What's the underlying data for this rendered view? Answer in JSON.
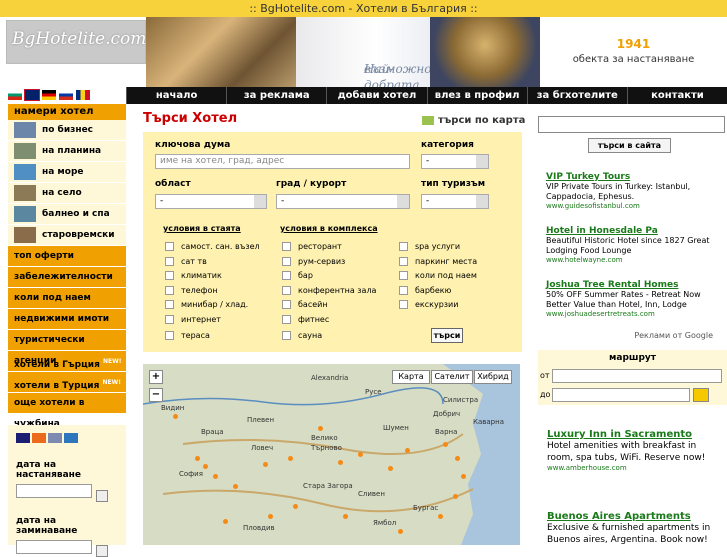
{
  "top_title": ":: BgHotelite.com - Хотели в България ::",
  "header": {
    "logo_text": "BgHotelite.com",
    "slogan_line1": "Най-добрата",
    "slogan_line2": "възможност!",
    "counter_number": "1941",
    "counter_text": "обекта за настаняване"
  },
  "nav": [
    "начало",
    "за реклама",
    "добави хотел",
    "влез в профил",
    "за бгхотелите",
    "контакти"
  ],
  "sidebar": {
    "title": "намери хотел",
    "items": [
      {
        "label": "по бизнес",
        "color": "#6b86a8"
      },
      {
        "label": "на планина",
        "color": "#7d8f70"
      },
      {
        "label": "на море",
        "color": "#4f8fc4"
      },
      {
        "label": "на село",
        "color": "#8b7a55"
      },
      {
        "label": "балнео и спа",
        "color": "#5b88a0"
      },
      {
        "label": "старовремски",
        "color": "#8a6b4a"
      }
    ],
    "categories": [
      "топ оферти",
      "забележителности",
      "коли под наем",
      "недвижими имоти",
      "туристически агенции",
      "хотели в Гърция",
      "хотели в Турция",
      "още хотели в чужбина"
    ],
    "new_badge": "NEW!"
  },
  "payments": {
    "arrival_label": "дата на настаняване",
    "departure_label": "дата на заминаване"
  },
  "search": {
    "title": "Търси Хотел",
    "map_link": "търси по карта",
    "keyword_label": "ключова дума",
    "keyword_placeholder": "име на хотел, град, адрес",
    "category_label": "категория",
    "category_value": "-",
    "region_label": "област",
    "region_value": "-",
    "city_label": "град / курорт",
    "city_value": "-",
    "tourism_label": "тип туризъм",
    "tourism_value": "-",
    "room_section": "условия в стаята",
    "complex_section": "условия в комплекса",
    "room_options": [
      "самост. сан. възел",
      "сат тв",
      "климатик",
      "телефон",
      "минибар / хлад.",
      "интернет",
      "тераса"
    ],
    "complex_options": [
      "ресторант",
      "рум-сервиз",
      "бар",
      "конферентна зала",
      "басейн",
      "фитнес",
      "сауна"
    ],
    "extra_options": [
      "spa услуги",
      "паркинг места",
      "коли под наем",
      "барбекю",
      "екскурзии"
    ],
    "button": "търси"
  },
  "map": {
    "zoom_in": "+",
    "zoom_out": "−",
    "types": [
      "Карта",
      "Сателит",
      "Хибрид"
    ],
    "cities": [
      "Alexandria",
      "Русе",
      "Силистра",
      "Видин",
      "Плевен",
      "Враца",
      "Ловеч",
      "Велико",
      "Търново",
      "Шумен",
      "Варна",
      "Добрич",
      "Каварна",
      "София",
      "Стара Загора",
      "Сливен",
      "Бургас",
      "Пловдив",
      "Ямбол"
    ]
  },
  "right": {
    "site_search_button": "търси в сайта",
    "ads": [
      {
        "title": "VIP Turkey Tours",
        "text": "VIP Private Tours in Turkey: Istanbul, Cappadocia, Ephesus.",
        "url": "www.guidesofistanbul.com"
      },
      {
        "title": "Hotel in Honesdale Pa",
        "text": "Beautiful Historic Hotel since 1827 Great Lodging Food Lounge",
        "url": "www.hotelwayne.com"
      },
      {
        "title": "Joshua Tree Rental Homes",
        "text": "50% OFF Summer Rates - Retreat Now Better Value than Hotel, Inn, Lodge",
        "url": "www.joshuadesertretreats.com"
      }
    ],
    "ads_by": "Реклами от Google",
    "route_title": "маршрут",
    "route_from": "от",
    "route_to": "до",
    "ads2": [
      {
        "title": "Luxury Inn in Sacramento",
        "text": "Hotel amenities with breakfast in room, spa tubs, WiFi. Reserve now!",
        "url": "www.amberhouse.com"
      },
      {
        "title": "Buenos Aires Apartments",
        "text": "Exclusive & furnished apartments in Buenos aires, Argentina. Book now!",
        "url": ""
      }
    ]
  }
}
